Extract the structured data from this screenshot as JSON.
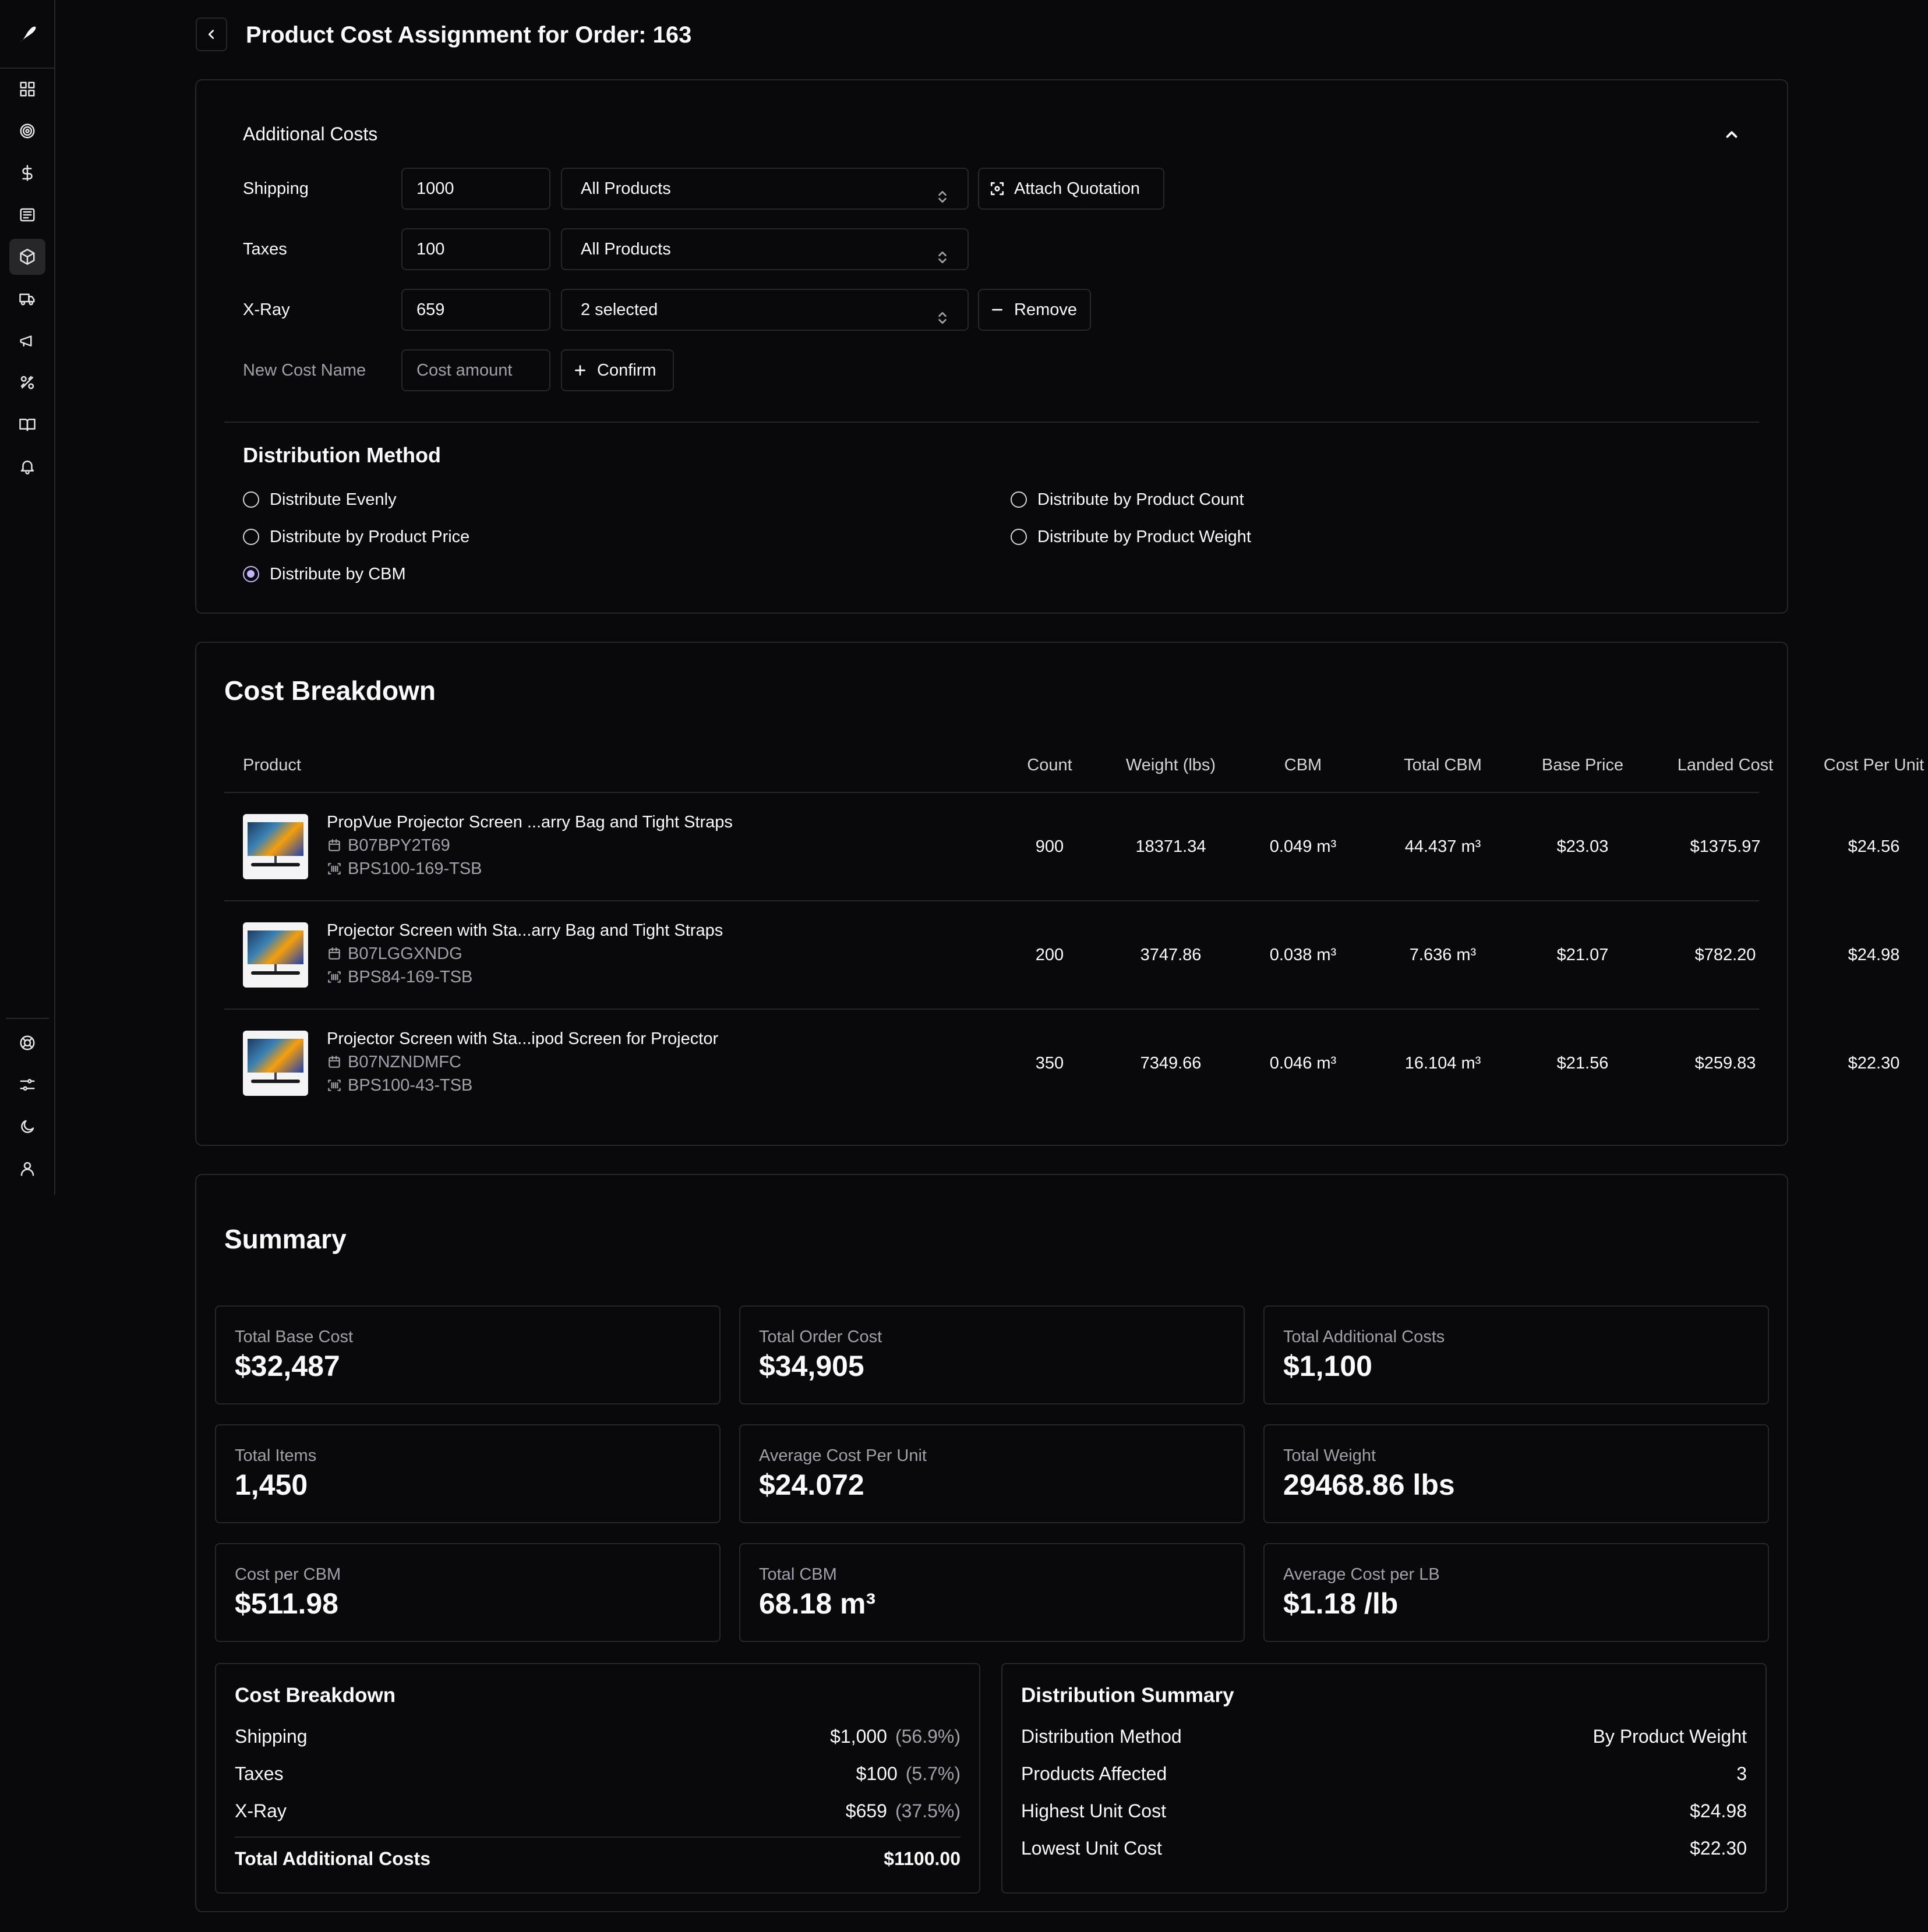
{
  "page": {
    "title": "Product Cost Assignment for Order: 163"
  },
  "additional_costs": {
    "title": "Additional Costs",
    "rows": [
      {
        "name": "Shipping",
        "amount": "1000",
        "selector": "All Products",
        "action": "Attach Quotation"
      },
      {
        "name": "Taxes",
        "amount": "100",
        "selector": "All Products"
      },
      {
        "name": "X-Ray",
        "amount": "659",
        "selector": "2 selected",
        "action": "Remove"
      }
    ],
    "new_cost": {
      "name_placeholder": "New Cost Name",
      "amount_placeholder": "Cost amount",
      "confirm_label": "Confirm"
    }
  },
  "distribution": {
    "title": "Distribution Method",
    "options": [
      {
        "label": "Distribute Evenly",
        "checked": false
      },
      {
        "label": "Distribute by Product Count",
        "checked": false
      },
      {
        "label": "Distribute by Product Price",
        "checked": false
      },
      {
        "label": "Distribute by Product Weight",
        "checked": false
      },
      {
        "label": "Distribute by CBM",
        "checked": true
      }
    ]
  },
  "cost_breakdown_table": {
    "title": "Cost Breakdown",
    "columns": [
      "Product",
      "Count",
      "Weight (lbs)",
      "CBM",
      "Total CBM",
      "Base Price",
      "Landed Cost",
      "Cost Per Unit"
    ],
    "rows": [
      {
        "name": "PropVue Projector Screen ...arry Bag and Tight Straps",
        "asin": "B07BPY2T69",
        "sku": "BPS100-169-TSB",
        "count": "900",
        "weight": "18371.34",
        "cbm": "0.049 m³",
        "total_cbm": "44.437 m³",
        "base_price": "$23.03",
        "landed_cost": "$1375.97",
        "cost_per_unit": "$24.56"
      },
      {
        "name": "Projector Screen with Sta...arry Bag and Tight Straps",
        "asin": "B07LGGXNDG",
        "sku": "BPS84-169-TSB",
        "count": "200",
        "weight": "3747.86",
        "cbm": "0.038 m³",
        "total_cbm": "7.636 m³",
        "base_price": "$21.07",
        "landed_cost": "$782.20",
        "cost_per_unit": "$24.98"
      },
      {
        "name": "Projector Screen with Sta...ipod Screen for Projector",
        "asin": "B07NZNDMFC",
        "sku": "BPS100-43-TSB",
        "count": "350",
        "weight": "7349.66",
        "cbm": "0.046 m³",
        "total_cbm": "16.104 m³",
        "base_price": "$21.56",
        "landed_cost": "$259.83",
        "cost_per_unit": "$22.30"
      }
    ]
  },
  "summary": {
    "title": "Summary",
    "stats": [
      {
        "label": "Total Base Cost",
        "value": "$32,487"
      },
      {
        "label": "Total Order Cost",
        "value": "$34,905"
      },
      {
        "label": "Total Additional Costs",
        "value": "$1,100"
      },
      {
        "label": "Total Items",
        "value": "1,450"
      },
      {
        "label": "Average Cost Per Unit",
        "value": "$24.072"
      },
      {
        "label": "Total Weight",
        "value": "29468.86 lbs"
      },
      {
        "label": "Cost per CBM",
        "value": "$511.98"
      },
      {
        "label": "Total CBM",
        "value": "68.18 m³"
      },
      {
        "label": "Average Cost per LB",
        "value": "$1.18 /lb"
      }
    ],
    "cost_breakdown": {
      "title": "Cost Breakdown",
      "items": [
        {
          "label": "Shipping",
          "value": "$1,000",
          "pct": "(56.9%)"
        },
        {
          "label": "Taxes",
          "value": "$100",
          "pct": "(5.7%)"
        },
        {
          "label": "X-Ray",
          "value": "$659",
          "pct": "(37.5%)"
        }
      ],
      "total_label": "Total Additional Costs",
      "total_value": "$1100.00"
    },
    "distribution_summary": {
      "title": "Distribution Summary",
      "items": [
        {
          "label": "Distribution Method",
          "value": "By Product Weight"
        },
        {
          "label": "Products Affected",
          "value": "3"
        },
        {
          "label": "Highest Unit Cost",
          "value": "$24.98"
        },
        {
          "label": "Lowest Unit Cost",
          "value": "$22.30"
        }
      ]
    }
  },
  "colors": {
    "background": "#09090b",
    "border": "#27272a",
    "muted_text": "#a1a1aa",
    "radio_accent": "#c4b5fd"
  }
}
